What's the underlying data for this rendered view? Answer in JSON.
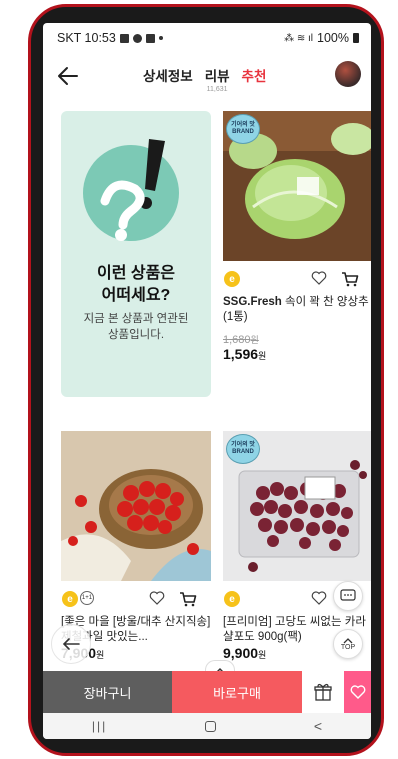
{
  "status": {
    "carrier_time": "SKT 10:53",
    "battery": "100%"
  },
  "header": {
    "tabs": [
      {
        "label": "상세정보",
        "count": ""
      },
      {
        "label": "리뷰",
        "count": "11,631"
      },
      {
        "label": "추천",
        "count": ""
      }
    ]
  },
  "promo": {
    "title_line1": "이런 상품은",
    "title_line2": "어떠세요?",
    "desc_line1": "지금 본 상품과 연관된",
    "desc_line2": "상품입니다."
  },
  "products": [
    {
      "badge": "기어의 맛 BRAND",
      "brand": "SSG.Fresh",
      "name": " 속이 꽉 찬 양상추(1통)",
      "original_price": "1,680",
      "price": "1,596",
      "unit": "원",
      "coin": "e",
      "tag": ""
    },
    {
      "badge": "",
      "brand": "",
      "name": "[좋은 마을 [방울/대추 산지직송] 제철과일 맛있는...",
      "original_price": "",
      "price": "7,900",
      "unit": "원",
      "coin": "e",
      "tag": "1+1"
    },
    {
      "badge": "기어의 맛 BRAND",
      "brand": "",
      "name": "[프리미엄] 고당도 씨없는 카라샬포도 900g(팩)",
      "original_price": "",
      "price": "9,900",
      "unit": "원",
      "coin": "e",
      "tag": ""
    }
  ],
  "floating": {
    "top_label": "TOP"
  },
  "bottom": {
    "cart_label": "장바구니",
    "buy_label": "바로구매"
  },
  "colors": {
    "accent_red": "#e8333d",
    "buy_button": "#f55a5f",
    "cart_button": "#5e5e5e",
    "promo_bg": "#d9efe7",
    "like_button": "#ff5a8a"
  }
}
